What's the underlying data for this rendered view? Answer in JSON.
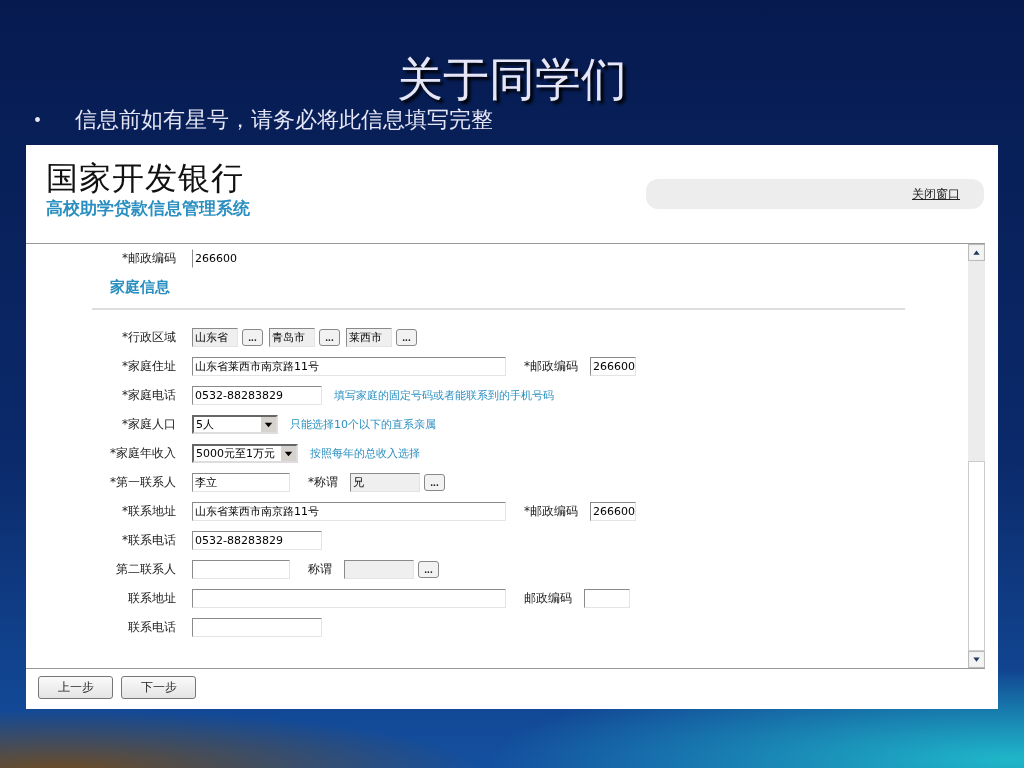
{
  "slide": {
    "title": "关于同学们",
    "bullet": "•",
    "note": "信息前如有星号，请务必将此信息填写完整"
  },
  "app": {
    "brand": "国家开发银行",
    "subtitle": "高校助学贷款信息管理系统",
    "close_link": "关闭窗口"
  },
  "form": {
    "rows": [
      {
        "kind": "fields",
        "label": "*邮政编码",
        "items": [
          {
            "kind": "partial",
            "value": "266600"
          }
        ]
      },
      {
        "kind": "section",
        "title": "家庭信息"
      },
      {
        "kind": "fields",
        "label": "*行政区域",
        "items": [
          {
            "kind": "region",
            "value": "山东省",
            "button": "..."
          },
          {
            "kind": "region",
            "value": "青岛市",
            "button": "..."
          },
          {
            "kind": "region",
            "value": "莱西市",
            "button": "..."
          }
        ]
      },
      {
        "kind": "fields",
        "label": "*家庭住址",
        "items": [
          {
            "kind": "address",
            "value": "山东省莱西市南京路11号"
          },
          {
            "kind": "label",
            "text": "*邮政编码"
          },
          {
            "kind": "postal",
            "value": "266600"
          }
        ]
      },
      {
        "kind": "fields",
        "label": "*家庭电话",
        "items": [
          {
            "kind": "phone",
            "value": "0532-88283829"
          },
          {
            "kind": "hint",
            "text": "填写家庭的固定号码或者能联系到的手机号码"
          }
        ]
      },
      {
        "kind": "fields",
        "label": "*家庭人口",
        "items": [
          {
            "kind": "count",
            "value": "5人"
          },
          {
            "kind": "hint",
            "text": "只能选择10个以下的直系亲属"
          }
        ]
      },
      {
        "kind": "fields",
        "label": "*家庭年收入",
        "items": [
          {
            "kind": "income",
            "value": "5000元至1万元"
          },
          {
            "kind": "hint",
            "text": "按照每年的总收入选择"
          }
        ]
      },
      {
        "kind": "fields",
        "label": "*第一联系人",
        "items": [
          {
            "kind": "name",
            "value": "李立"
          },
          {
            "kind": "label",
            "text": "*称谓"
          },
          {
            "kind": "relation",
            "value": "兄",
            "button": "..."
          }
        ]
      },
      {
        "kind": "fields",
        "label": "*联系地址",
        "items": [
          {
            "kind": "address",
            "value": "山东省莱西市南京路11号"
          },
          {
            "kind": "label",
            "text": "*邮政编码"
          },
          {
            "kind": "postal",
            "value": "266600"
          }
        ]
      },
      {
        "kind": "fields",
        "label": "*联系电话",
        "items": [
          {
            "kind": "phone",
            "value": "0532-88283829"
          }
        ]
      },
      {
        "kind": "fields",
        "label": "第二联系人",
        "items": [
          {
            "kind": "name"
          },
          {
            "kind": "label",
            "text": "称谓"
          },
          {
            "kind": "relation",
            "button": "..."
          }
        ]
      },
      {
        "kind": "fields",
        "label": "联系地址",
        "items": [
          {
            "kind": "address"
          },
          {
            "kind": "label",
            "text": "邮政编码"
          },
          {
            "kind": "postal"
          }
        ]
      },
      {
        "kind": "fields",
        "label": "联系电话",
        "items": [
          {
            "kind": "phone"
          }
        ]
      }
    ]
  },
  "buttons": [
    "上一步",
    "下一步"
  ]
}
